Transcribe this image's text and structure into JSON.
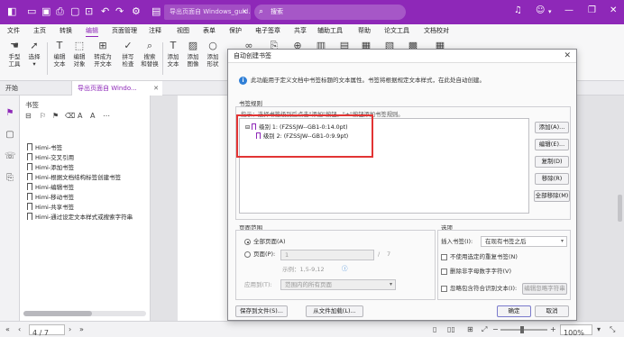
{
  "window": {
    "doc_tab": "导出页面自 Windows_guid...",
    "search_placeholder": "搜索"
  },
  "menu": [
    "文件",
    "主页",
    "转换",
    "编辑",
    "页面管理",
    "注释",
    "视图",
    "表单",
    "保护",
    "电子签章",
    "共享",
    "辅助工具",
    "帮助",
    "论文工具",
    "文档校对"
  ],
  "menu_active": "编辑",
  "ribbon": [
    {
      "l1": "手型",
      "l2": "工具",
      "icon": "hand-icon"
    },
    {
      "l1": "选择",
      "l2": "",
      "icon": "cursor-icon"
    },
    {
      "l1": "编辑",
      "l2": "文本",
      "icon": "edit-text-icon"
    },
    {
      "l1": "编辑",
      "l2": "对象",
      "icon": "edit-object-icon"
    },
    {
      "l1": "转成为",
      "l2": "开文本",
      "icon": "convert-text-icon"
    },
    {
      "l1": "拼写",
      "l2": "检查",
      "icon": "spellcheck-icon"
    },
    {
      "l1": "搜索",
      "l2": "和替换",
      "icon": "search-replace-icon"
    },
    {
      "l1": "添加",
      "l2": "文本",
      "icon": "add-text-icon"
    },
    {
      "l1": "添加",
      "l2": "图像",
      "icon": "add-image-icon"
    },
    {
      "l1": "添加",
      "l2": "形状",
      "icon": "add-shape-icon"
    }
  ],
  "tabs": {
    "start": "开始",
    "export": "导出页面自 Windo..."
  },
  "bookmarks": {
    "title": "书签",
    "items": [
      "Himi-书签",
      "Himi-交叉引用",
      "Himi-添加书签",
      "Himi-根据文档结构标签创建书签",
      "Himi-编辑书签",
      "Himi-移动书签",
      "Himi-共享书签",
      "Himi-通过设定文本样式或搜索字符串"
    ]
  },
  "status": {
    "page": "4 / 7",
    "zoom": "100%"
  },
  "dialog": {
    "title": "自动创建书签",
    "info": "此功能用于定义文档中书签标题的文本属性。书签将根据规定文本样式，在此处自动创建。",
    "rules_group": "书签规则",
    "rules_desc": "指示：选择书签级别后点击\"添加\"按钮。\"+\"按钮添加书签规则。",
    "rules": [
      "级别 1: (FZSSJW--GB1-0:14.0pt)",
      "级别 2: (FZSSJW--GB1-0:9.9pt)"
    ],
    "side_buttons": [
      "添加(A)...",
      "编辑(E)...",
      "复制(D)",
      "移除(R)",
      "全部移除(M)"
    ],
    "range_group": "页面范围",
    "all_pages": "全部页面(A)",
    "page_range": "页面(P):",
    "page_from": "1",
    "page_sep": "/",
    "page_total": "7",
    "example": "示例：1,5-9,12",
    "apply_label": "应用到(T):",
    "apply_value": "范围内的所有页面",
    "options_group": "选项",
    "insert_label": "插入书签(I):",
    "insert_value": "在现有书签之后",
    "opt1": "不使用选定的重复书签(N)",
    "opt2": "删除非字母数字字符(V)",
    "opt3": "忽略包含符合识别文本(I):",
    "opt3_button": "编辑忽略字符串",
    "save_button": "保存到文件(S)...",
    "load_button": "从文件加载(L)...",
    "ok_button": "确定",
    "cancel_button": "取消"
  }
}
